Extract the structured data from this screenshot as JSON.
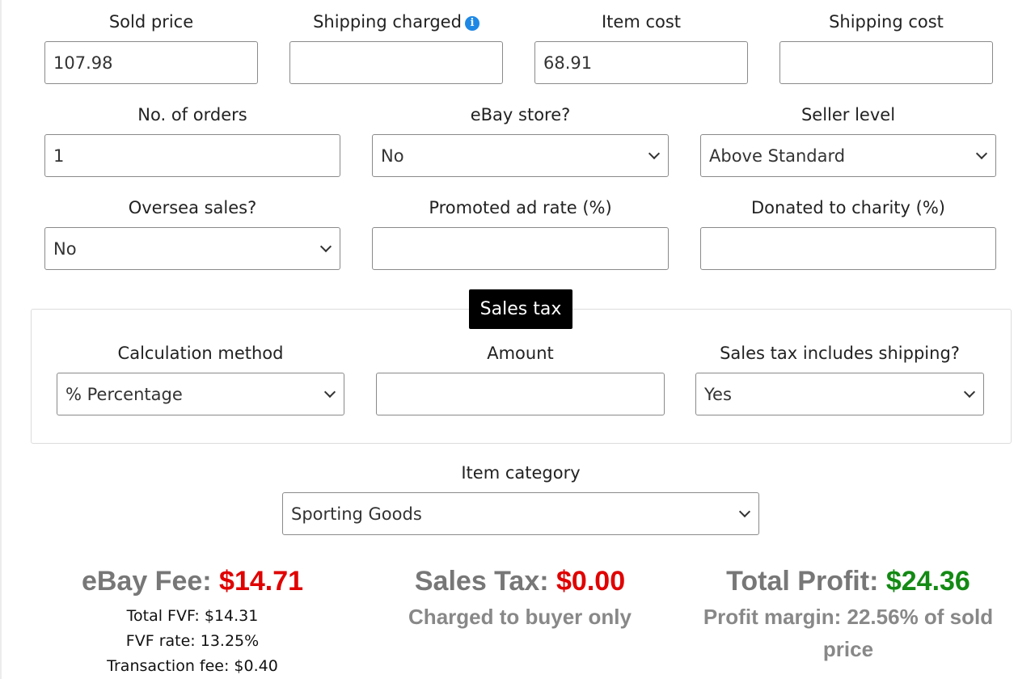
{
  "row1": [
    {
      "key": "sold_price",
      "label": "Sold price",
      "value": "107.98"
    },
    {
      "key": "shipping_charged",
      "label": "Shipping charged",
      "value": "",
      "info_icon": "info-icon"
    },
    {
      "key": "item_cost",
      "label": "Item cost",
      "value": "68.91"
    },
    {
      "key": "shipping_cost",
      "label": "Shipping cost",
      "value": ""
    }
  ],
  "row2": [
    {
      "key": "no_of_orders",
      "label": "No. of orders",
      "value": "1"
    },
    {
      "key": "ebay_store",
      "label": "eBay store?",
      "value": "No"
    },
    {
      "key": "seller_level",
      "label": "Seller level",
      "value": "Above Standard"
    }
  ],
  "row3": [
    {
      "key": "oversea_sales",
      "label": "Oversea sales?",
      "value": "No"
    },
    {
      "key": "promoted_ad_rate",
      "label": "Promoted ad rate (%)",
      "value": ""
    },
    {
      "key": "donated_to_charity",
      "label": "Donated to charity (%)",
      "value": ""
    }
  ],
  "sales_tax": {
    "title": "Sales tax",
    "calculation_method": {
      "label": "Calculation method",
      "value": "% Percentage"
    },
    "amount": {
      "label": "Amount",
      "value": ""
    },
    "includes_shipping": {
      "label": "Sales tax includes shipping?",
      "value": "Yes"
    }
  },
  "item_category": {
    "label": "Item category",
    "value": "Sporting Goods"
  },
  "results": {
    "ebay_fee": {
      "label": "eBay Fee:",
      "value": "$14.71",
      "lines": [
        "Total FVF: $14.31",
        "FVF rate: 13.25%",
        "Transaction fee: $0.40"
      ]
    },
    "sales_tax": {
      "label": "Sales Tax:",
      "value": "$0.00",
      "note": "Charged to buyer only"
    },
    "total_profit": {
      "label": "Total Profit:",
      "value": "$24.36",
      "note": "Profit margin: 22.56% of sold price"
    }
  },
  "colors": {
    "fee": "#e00000",
    "profit": "#138a13",
    "info": "#1e88e5"
  }
}
